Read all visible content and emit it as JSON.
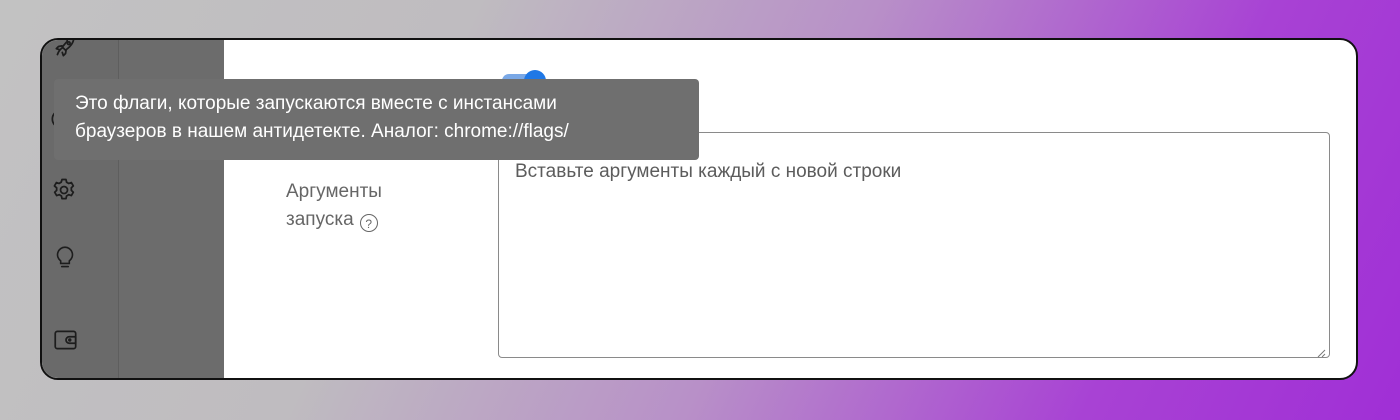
{
  "sidebar": {
    "icons": [
      "rocket-icon",
      "settings-icon",
      "lightbulb-icon",
      "wallet-icon"
    ]
  },
  "toggle": {
    "state": "on",
    "color": "#1f78e6"
  },
  "field": {
    "label_line1": "Аргументы",
    "label_line2": "запуска",
    "help_glyph": "?",
    "placeholder": "Вставьте аргументы каждый с новой строки",
    "value": ""
  },
  "tooltip": {
    "line1": "Это флаги, которые запускаются вместе с инстансами",
    "line2": "браузеров в нашем антидетекте. Аналог: chrome://flags/"
  }
}
